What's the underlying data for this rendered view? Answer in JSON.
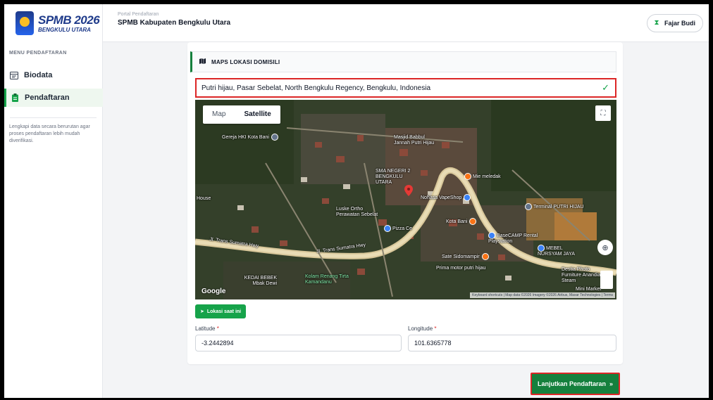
{
  "brand": {
    "title": "SPMB 2026",
    "subtitle": "BENGKULU UTARA"
  },
  "header": {
    "kicker": "Portal Pendaftaran",
    "title": "SPMB Kabupaten Bengkulu Utara"
  },
  "user": {
    "name": "Fajar Budi",
    "icon": "hourglass-icon"
  },
  "sidebar": {
    "heading": "MENU PENDAFTARAN",
    "items": [
      {
        "label": "Biodata",
        "icon": "id-card-icon",
        "active": false
      },
      {
        "label": "Pendaftaran",
        "icon": "clipboard-icon",
        "active": true
      }
    ],
    "note": "Lengkapi data secara berurutan agar proses pendaftaran lebih mudah diverifikasi."
  },
  "section": {
    "title": "MAPS LOKASI DOMISILI",
    "icon": "map-icon"
  },
  "address": {
    "value": "Putri hijau, Pasar Sebelat, North Bengkulu Regency, Bengkulu, Indonesia",
    "status_icon": "check-icon"
  },
  "map": {
    "tabs": [
      {
        "label": "Map",
        "active": false
      },
      {
        "label": "Satellite",
        "active": true
      }
    ],
    "google": "Google",
    "attribution": "Keyboard shortcuts | Map data ©2026 Imagery ©2026 Airbus, Maxar Technologies | Terms",
    "pois": [
      "Gereja HKI Kota Bani",
      "Masjid Babbul Jannah Putri Hijau",
      "SMA NEGERI 2 BENGKULU UTARA",
      "Mie meledak",
      "Nohasa VapeShop",
      "Terminal PUTRI HIJAU",
      "Luske Ortho Perawatan Sebelat",
      "Pizza Ce",
      "Kota Bani",
      "BaseCAMP Rental Playstation",
      "MEBEL NURSYAM JAYA",
      "Jl. Trans Sumatra Hwy",
      "Jl. Trans Sumatra Hwy",
      "Sate Sidomampir",
      "Prima motor putri hijau",
      "Destia Photo Furniture Anandia Steam",
      "Mini Market",
      "KEDAI BEBEK Mbak Dewi",
      "Kolam Renang Tirta Kamandanu",
      "House"
    ]
  },
  "buttons": {
    "current_location": "Lokasi saat ini",
    "continue": "Lanjutkan Pendaftaran"
  },
  "fields": {
    "latitude": {
      "label": "Latitude",
      "value": "-3.2442894"
    },
    "longitude": {
      "label": "Longitude",
      "value": "101.6365778"
    }
  },
  "colors": {
    "primary": "#16a34a",
    "highlight": "#dc2626",
    "brand": "#1e3a8a"
  }
}
